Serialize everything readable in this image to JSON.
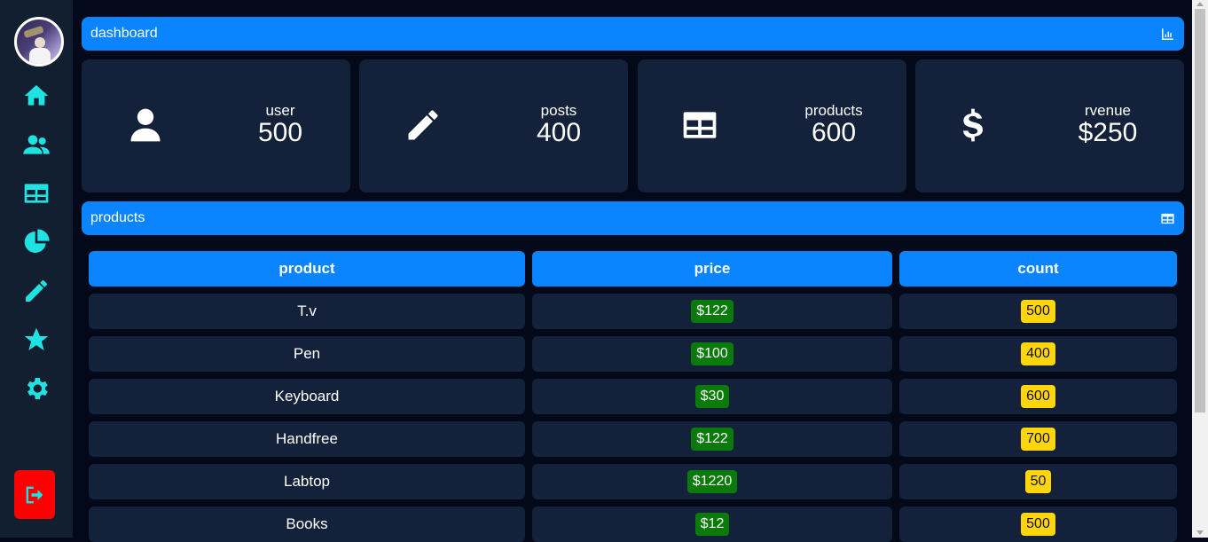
{
  "sidebar": {
    "nav": [
      "home-icon",
      "users-icon",
      "table-icon",
      "pie-chart-icon",
      "pencil-icon",
      "star-icon",
      "gear-icon"
    ],
    "logout_icon": "logout-icon"
  },
  "dashboard_bar": {
    "title": "dashboard",
    "icon": "bar-chart-icon"
  },
  "stats": [
    {
      "label": "user",
      "value": "500",
      "icon": "user-icon"
    },
    {
      "label": "posts",
      "value": "400",
      "icon": "pencil-icon"
    },
    {
      "label": "products",
      "value": "600",
      "icon": "table-icon"
    },
    {
      "label": "rvenue",
      "value": "$250",
      "icon": "dollar-icon"
    }
  ],
  "products_bar": {
    "title": "products",
    "icon": "table-icon"
  },
  "table": {
    "headers": [
      "product",
      "price",
      "count"
    ],
    "rows": [
      {
        "product": "T.v",
        "price": "$122",
        "count": "500"
      },
      {
        "product": "Pen",
        "price": "$100",
        "count": "400"
      },
      {
        "product": "Keyboard",
        "price": "$30",
        "count": "600"
      },
      {
        "product": "Handfree",
        "price": "$122",
        "count": "700"
      },
      {
        "product": "Labtop",
        "price": "$1220",
        "count": "50"
      },
      {
        "product": "Books",
        "price": "$12",
        "count": "500"
      }
    ]
  },
  "colors": {
    "accent": "#0a85ff",
    "sidebar_icon": "#1fe3e3",
    "price_badge": "#0a7a0a",
    "count_badge": "#ffd60a",
    "logout": "#ff0000"
  }
}
